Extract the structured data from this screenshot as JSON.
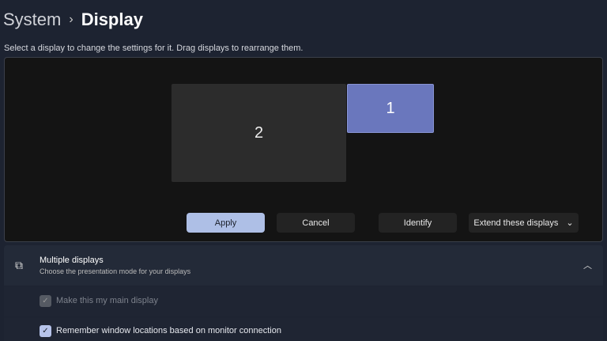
{
  "breadcrumb": {
    "parent": "System",
    "separator": "›",
    "current": "Display"
  },
  "hint": "Select a display to change the settings for it. Drag displays to rearrange them.",
  "monitors": [
    {
      "label": "2",
      "selected": false
    },
    {
      "label": "1",
      "selected": true
    }
  ],
  "buttons": {
    "apply": "Apply",
    "cancel": "Cancel",
    "identify": "Identify",
    "extend": "Extend these displays",
    "extend_chevron": "⌄"
  },
  "multiple_displays": {
    "icon": "multi-monitor-icon",
    "title": "Multiple displays",
    "subtitle": "Choose the presentation mode for your displays",
    "expanded": true,
    "caret": "︿"
  },
  "options": [
    {
      "label": "Make this my main display",
      "checked": true,
      "disabled": true
    },
    {
      "label": "Remember window locations based on monitor connection",
      "checked": true,
      "disabled": false
    }
  ],
  "check_glyph": "✓"
}
